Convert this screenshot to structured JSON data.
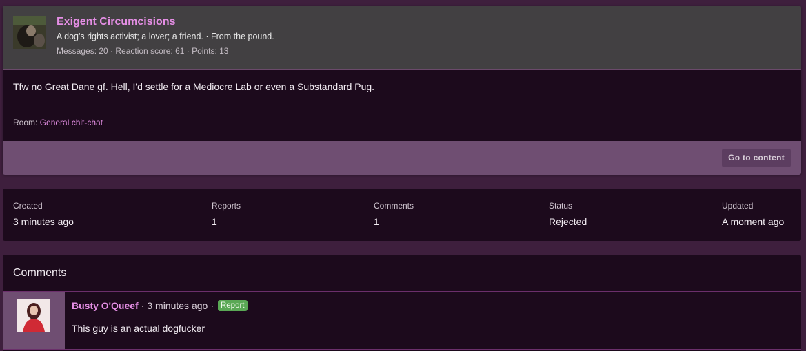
{
  "report": {
    "user": {
      "name": "Exigent Circumcisions",
      "title": "A dog's rights activist; a lover; a friend. · From the pound.",
      "stats": "Messages: 20 · Reaction score: 61 · Points: 13"
    },
    "message": "Tfw no Great Dane gf. Hell, I'd settle for a Mediocre Lab or even a Substandard Pug.",
    "room_label": "Room:",
    "room_link": "General chit-chat",
    "go_to_content": "Go to content"
  },
  "stats": [
    {
      "label": "Created",
      "value": "3 minutes ago"
    },
    {
      "label": "Reports",
      "value": "1"
    },
    {
      "label": "Comments",
      "value": "1"
    },
    {
      "label": "Status",
      "value": "Rejected"
    },
    {
      "label": "Updated",
      "value": "A moment ago"
    }
  ],
  "comments": {
    "title": "Comments",
    "items": [
      {
        "author": "Busty O'Queef",
        "time": "3 minutes ago",
        "badge": "Report",
        "text": "This guy is an actual dogfucker"
      }
    ]
  },
  "colors": {
    "accent": "#e48ee4",
    "badge": "#5aa855",
    "panel": "#1c0a1c",
    "footer": "#6f4e72"
  }
}
